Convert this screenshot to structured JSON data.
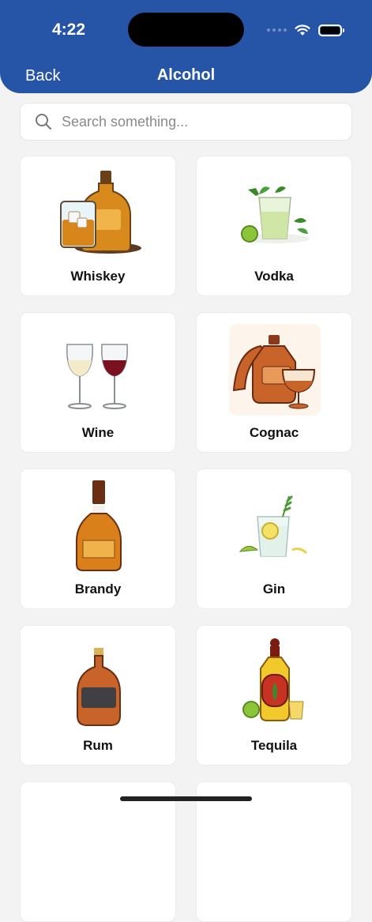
{
  "status": {
    "time": "4:22"
  },
  "nav": {
    "back_label": "Back",
    "title": "Alcohol"
  },
  "search": {
    "placeholder": "Search something..."
  },
  "categories": [
    {
      "label": "Whiskey",
      "icon": "whiskey-bottle-glass"
    },
    {
      "label": "Vodka",
      "icon": "vodka-cocktail"
    },
    {
      "label": "Wine",
      "icon": "wine-glasses"
    },
    {
      "label": "Cognac",
      "icon": "cognac-bottle-glass"
    },
    {
      "label": "Brandy",
      "icon": "brandy-bottle"
    },
    {
      "label": "Gin",
      "icon": "gin-tonic-glass"
    },
    {
      "label": "Rum",
      "icon": "rum-bottle"
    },
    {
      "label": "Tequila",
      "icon": "tequila-bottle"
    }
  ],
  "colors": {
    "header": "#2655a8",
    "background": "#f3f3f3",
    "card": "#ffffff"
  }
}
